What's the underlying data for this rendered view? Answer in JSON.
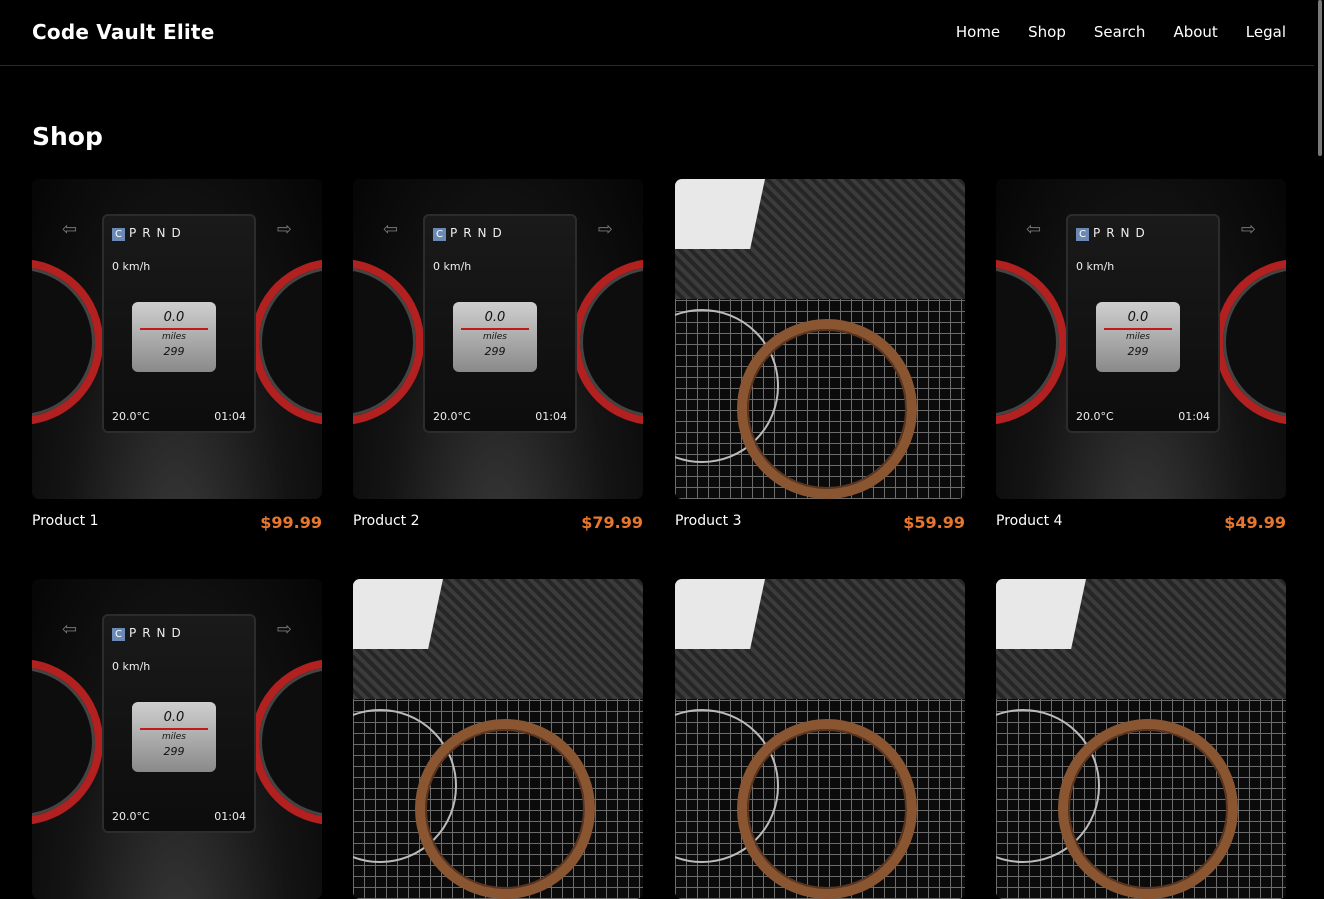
{
  "site": {
    "brand": "Code Vault Elite"
  },
  "nav": [
    {
      "label": "Home"
    },
    {
      "label": "Shop"
    },
    {
      "label": "Search"
    },
    {
      "label": "About"
    },
    {
      "label": "Legal"
    }
  ],
  "page": {
    "title": "Shop"
  },
  "dash_screen": {
    "gear_c": "C",
    "gears": "PRND",
    "speed": "0 km/h",
    "trip_value": "0.0",
    "trip_unit": "miles",
    "odometer": "299",
    "temperature": "20.0°C",
    "time": "01:04"
  },
  "products": [
    {
      "name": "Product 1",
      "price": "$99.99",
      "image": "dashboard"
    },
    {
      "name": "Product 2",
      "price": "$79.99",
      "image": "dashboard"
    },
    {
      "name": "Product 3",
      "price": "$59.99",
      "image": "ring-mat"
    },
    {
      "name": "Product 4",
      "price": "$49.99",
      "image": "dashboard"
    }
  ],
  "colors": {
    "background": "#000000",
    "text": "#ffffff",
    "price": "#e8772e"
  }
}
